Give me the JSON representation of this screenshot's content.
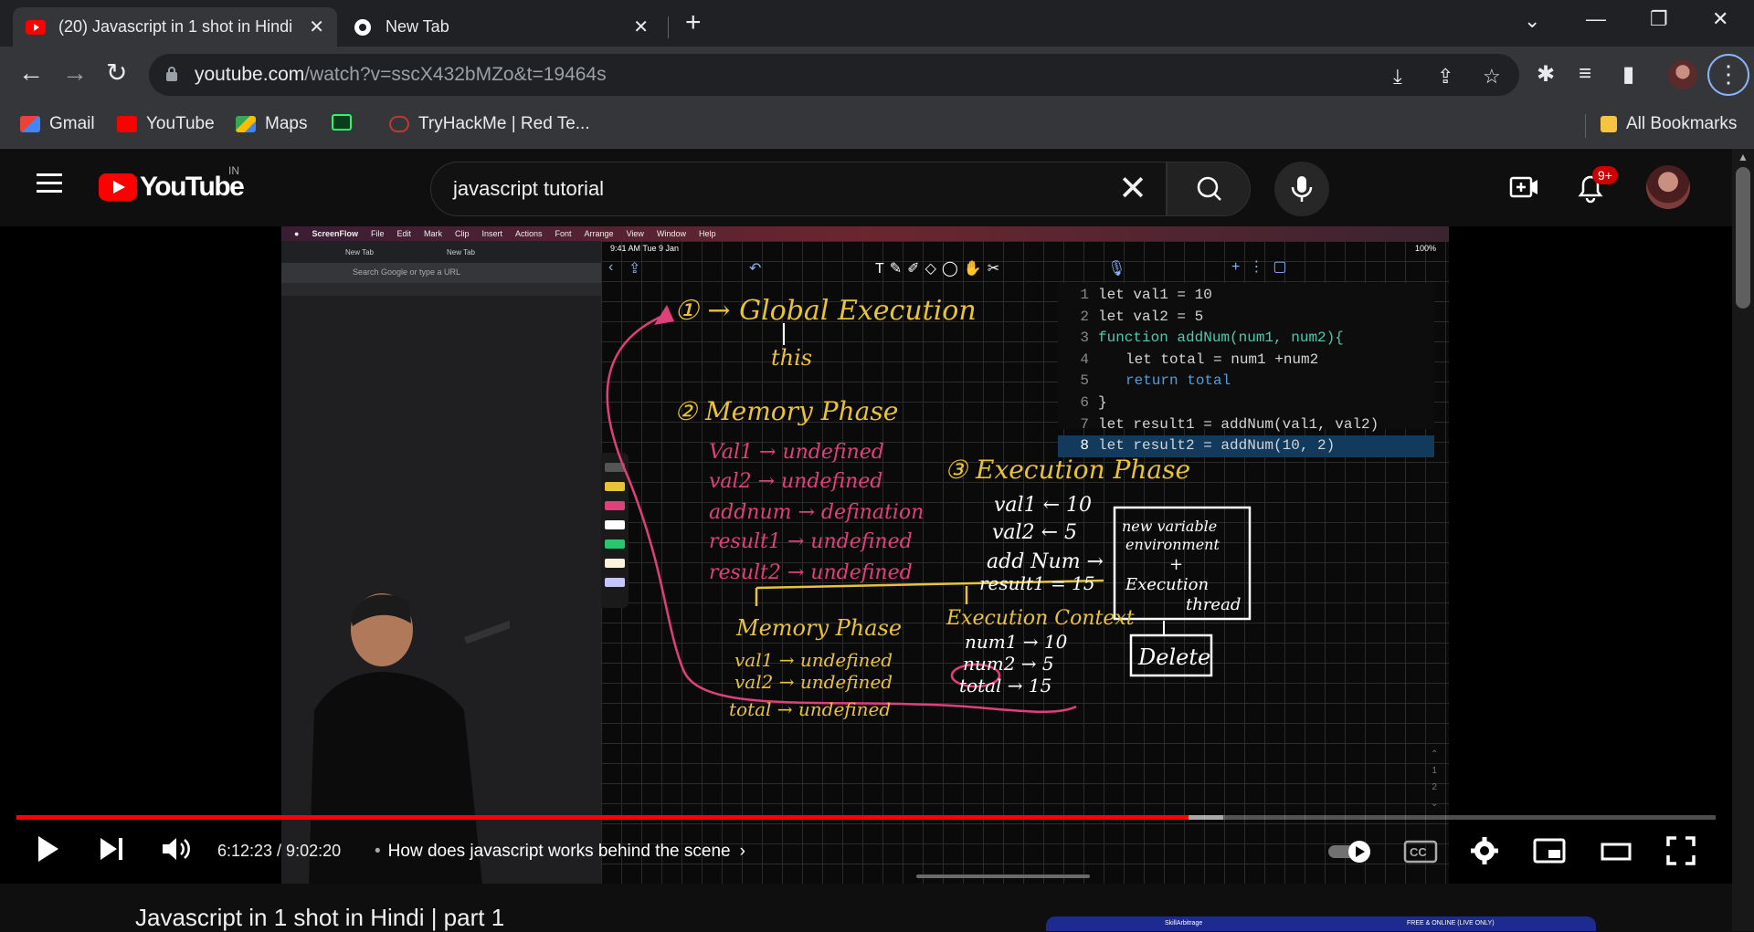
{
  "browser": {
    "tabs": [
      {
        "title": "(20) Javascript in 1 shot in Hindi",
        "active": true,
        "favicon": "youtube-icon"
      },
      {
        "title": "New Tab",
        "active": false,
        "favicon": "chrome-icon"
      }
    ],
    "url_host": "youtube.com",
    "url_path": "/watch?v=sscX432bMZo&t=19464s",
    "bookmarks": [
      {
        "label": "Gmail",
        "icon": "gmail-icon"
      },
      {
        "label": "YouTube",
        "icon": "youtube-icon"
      },
      {
        "label": "Maps",
        "icon": "maps-icon"
      },
      {
        "label": "",
        "icon": "extension-icon"
      },
      {
        "label": "TryHackMe | Red Te...",
        "icon": "tryhackme-icon"
      }
    ],
    "all_bookmarks": "All Bookmarks"
  },
  "youtube": {
    "logo_text": "YouTube",
    "country": "IN",
    "search_query": "javascript tutorial",
    "notifications": "9+"
  },
  "video": {
    "mac_menu": [
      "ScreenFlow",
      "File",
      "Edit",
      "Mark",
      "Clip",
      "Insert",
      "Actions",
      "Font",
      "Arrange",
      "View",
      "Window",
      "Help"
    ],
    "ipad_time": "9:41 AM  Tue 9 Jan",
    "ipad_battery": "100%",
    "left_tabs": [
      "New Tab",
      "New Tab"
    ],
    "left_search": "Search Google or type a URL",
    "code_lines": [
      {
        "n": "1",
        "text": "let val1 = 10"
      },
      {
        "n": "2",
        "text": "let val2 = 5"
      },
      {
        "n": "3",
        "text": "function addNum(num1, num2){"
      },
      {
        "n": "4",
        "text": "let total = num1 +num2"
      },
      {
        "n": "5",
        "text": "return total"
      },
      {
        "n": "6",
        "text": "}"
      },
      {
        "n": "7",
        "text": "let result1 = addNum(val1, val2)"
      },
      {
        "n": "8",
        "text": "let result2 = addNum(10, 2)"
      }
    ],
    "ink": {
      "global": "① → Global Execution",
      "this": "this",
      "memory_phase": "② Memory Phase",
      "mem_lines": [
        "Val1 → undefined",
        "val2 → undefined",
        "addnum → defination",
        "result1 → undefined",
        "result2 → undefined"
      ],
      "execution_phase": "③ Execution Phase",
      "exec_lines": [
        "val1 ← 10",
        "val2 ← 5",
        "add Num →",
        "result1 = 15"
      ],
      "box_lines": [
        "new variable",
        "environment",
        "+",
        "Execution",
        "thread"
      ],
      "delete": "Delete",
      "memory_phase2": "Memory Phase",
      "mem2_lines": [
        "val1 → undefined",
        "val2 → undefined",
        "total → undefined"
      ],
      "exec_context": "Execution Context",
      "ctx_lines": [
        "num1 → 10",
        "num2 → 5",
        "total → 15"
      ]
    }
  },
  "player": {
    "progress": 0.69,
    "buffered_to": 0.71,
    "time": "6:12:23 / 9:02:20",
    "chapter": "How does javascript works behind the scene"
  },
  "page": {
    "title": "Javascript in 1 shot in Hindi | part 1",
    "ad_left": "SkillArbitrage",
    "ad_right": "FREE & ONLINE (LIVE ONLY)"
  },
  "colors": {
    "accent_red": "#ff0000",
    "ink_yellow": "#e8c23a",
    "ink_pink": "#e0407a",
    "ink_white": "#ffffff"
  }
}
